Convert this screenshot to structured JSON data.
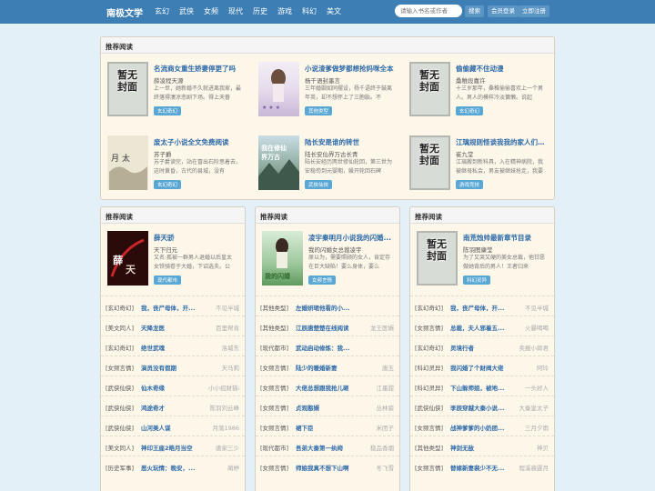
{
  "nav": {
    "brand": "南极文学",
    "links": [
      "玄幻",
      "武侠",
      "女频",
      "现代",
      "历史",
      "游戏",
      "科幻",
      "美文"
    ],
    "search_placeholder": "请输入书名或作者",
    "search_button": "搜索",
    "favorite_button": "会员登录",
    "register_button": "立即注册"
  },
  "top_panel": {
    "header": "推荐阅读",
    "books": [
      {
        "title": "名流商女重生娇妻停更了吗",
        "author": "薛凌程天源",
        "desc": "上一世，她新婚不久就进离我家，最终落得凄凉悲剧下场。得上天眷",
        "tag": "玄幻奇幻",
        "cover": "placeholder"
      },
      {
        "title": "小说渣爹做梦都想抢妈咪全本",
        "author": "杨千语封墨言",
        "desc": "三年婚姻如同摆设，杨千语终于鼓离年英，却不想怀上了三胞胎。不",
        "tag": "其他类型",
        "cover": "pink"
      },
      {
        "title": "偷偷藏不住动漫",
        "author": "桑稚段嘉许",
        "desc": "十三岁那年，桑稚偷偷喜欢上一个男人。男人的模样冷淡慵懒。说起",
        "tag": "玄幻奇幻",
        "cover": "placeholder"
      },
      {
        "title": "废太子小说全文免费阅读",
        "author": "苏子爵",
        "desc": "苏子爵读完，站在冒出石阶思着去，这时黄昏，古代的县城，没有",
        "tag": "玄幻奇幻",
        "cover": "sketch"
      },
      {
        "title": "陆长安是谁的转世",
        "author": "陆长安仙界万古长青",
        "desc": "陆长安经历两世修仙轮回，第三世为安稳苟到元婴期，躲开轮回石碑",
        "tag": "武侠仙侠",
        "cover": "scenic"
      },
      {
        "title": "江璃规则怪谈我我的家人们…",
        "author": "崔九堂",
        "desc": "江璃搬到新科具，入在精神病院，我被继母私会，男友被继妹抢走，我要",
        "tag": "游戏竞技",
        "cover": "placeholder"
      }
    ]
  },
  "panels": [
    {
      "header": "推荐阅读",
      "feature": {
        "title": "薛天骄",
        "author": "天下归元",
        "desc": "又名:孤被一群男人退婚以后皇太女铁骑卷于大婚，下诏选夫。公",
        "tag": "现代都市",
        "cover": "red"
      },
      "rows": [
        {
          "cat": "[玄幻奇幻]",
          "title": "我，丧尸母体，开...",
          "author": "不见半城"
        },
        {
          "cat": "[美文同人]",
          "title": "天降龙医",
          "author": "百里帮肯"
        },
        {
          "cat": "[玄幻奇幻]",
          "title": "绝世武魂",
          "author": "洛城东"
        },
        {
          "cat": "[女频言情]",
          "title": "演员没有假期",
          "author": "天马莉"
        },
        {
          "cat": "[武侠仙侠]",
          "title": "仙木奇缘",
          "author": "小小招财猫a"
        },
        {
          "cat": "[武侠仙侠]",
          "title": "鸿途奇才",
          "author": "陈羽刘云峰"
        },
        {
          "cat": "[武侠仙侠]",
          "title": "山河美人谋",
          "author": "月落1986"
        },
        {
          "cat": "[美文同人]",
          "title": "神印王座2皓月当空",
          "author": "唐家三少"
        },
        {
          "cat": "[历史军事]",
          "title": "恶火玩情：晚安，...",
          "author": "蔺婷"
        }
      ]
    },
    {
      "header": "推荐阅读",
      "feature": {
        "title": "凌宇秦明月小说我的闪婚...",
        "author": "我的闪婚女总裁凌宇",
        "desc": "原以为，需要照顾的女人，肯定存在巨大缺陷！要么身体，要么",
        "tag": "女频言情",
        "cover": "scenic2"
      },
      "rows": [
        {
          "cat": "[其他类型]",
          "title": "左婚妍珺他看的小...",
          "author": ""
        },
        {
          "cat": "[其他类型]",
          "title": "江辰唐楚楚在线阅读",
          "author": "龙王医婿"
        },
        {
          "cat": "[现代都市]",
          "title": "武动启动修炼：我...",
          "author": ""
        },
        {
          "cat": "[女频言情]",
          "title": "陆少的暖婚新妻",
          "author": "唐玉"
        },
        {
          "cat": "[女频言情]",
          "title": "大佬总想跟我抢儿砸",
          "author": "江墨甜"
        },
        {
          "cat": "[女频言情]",
          "title": "贞观憨婿",
          "author": "丛林狼"
        },
        {
          "cat": "[女频言情]",
          "title": "裙下臣",
          "author": "米团子"
        },
        {
          "cat": "[现代都市]",
          "title": "吾弟大秦第一纨绔",
          "author": "稳品香烟"
        },
        {
          "cat": "[女频言情]",
          "title": "师娘我真不想下山啊",
          "author": "冬飞雪"
        }
      ]
    },
    {
      "header": "推荐阅读",
      "feature": {
        "title": "南荒烛帅最新章节目录",
        "author": "陈羽图康莹",
        "desc": "为了又哭又硬的美女总裁，他甘愿做她背后的男人！王者归来",
        "tag": "科幻灵异",
        "cover": "placeholder"
      },
      "rows": [
        {
          "cat": "[玄幻奇幻]",
          "title": "我，丧尸母体，开...",
          "author": "不见半城"
        },
        {
          "cat": "[女频言情]",
          "title": "总裁，夫人邪着五...",
          "author": "火暴喝喝"
        },
        {
          "cat": "[玄幻奇幻]",
          "title": "灵境行者",
          "author": "卖报小郎君"
        },
        {
          "cat": "[科幻灵异]",
          "title": "我闪婚了个财阀大佬",
          "author": "阿玲"
        },
        {
          "cat": "[科幻灵异]",
          "title": "下山躲师姐，被地...",
          "author": "一头好人"
        },
        {
          "cat": "[武侠仙侠]",
          "title": "李辰穿越大秦小说...",
          "author": "大秦皇太子"
        },
        {
          "cat": "[女频言情]",
          "title": "战神爹爹的小奶团...",
          "author": "三月夕雨"
        },
        {
          "cat": "[其他类型]",
          "title": "神剑无敌",
          "author": "神贝"
        },
        {
          "cat": "[女频言情]",
          "title": "替嫁新妻裴少不无...",
          "author": "程溪裴霆月"
        }
      ]
    }
  ],
  "placeholder_label": "暂无封面"
}
